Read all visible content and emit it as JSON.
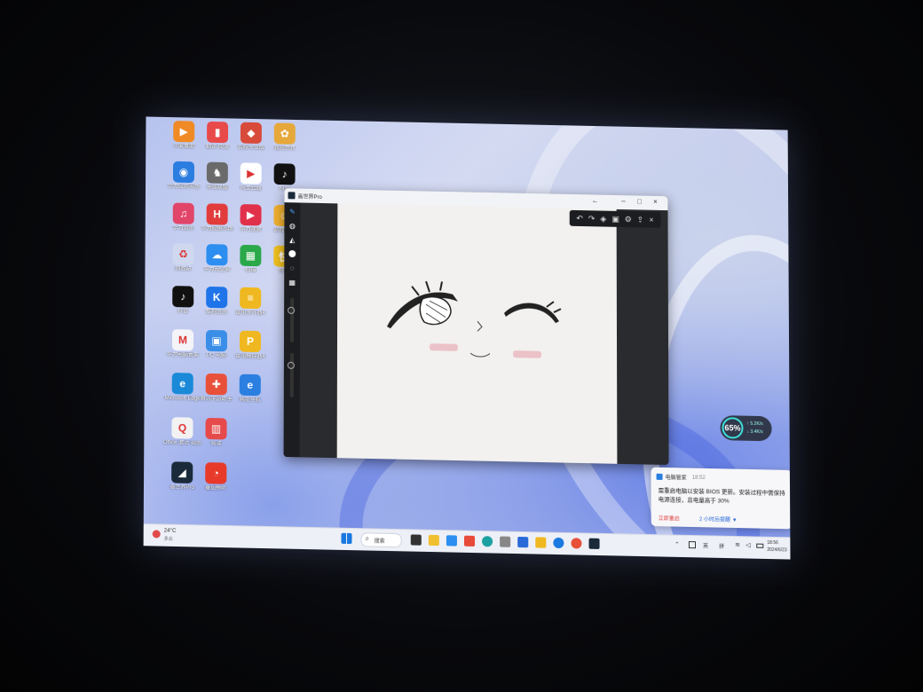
{
  "desktop": {
    "icons": [
      {
        "label": "小爱桌面",
        "glyph": "▶",
        "color": "#f08a24"
      },
      {
        "label": "翻译·阅读",
        "glyph": "▮",
        "color": "#e84a4a"
      },
      {
        "label": "剪映专业版",
        "glyph": "◆",
        "color": "#d84b3a"
      },
      {
        "label": "我的世界",
        "glyph": "✿",
        "color": "#e6a83a"
      },
      {
        "label": "华为应用市场",
        "glyph": "◉",
        "color": "#2b7de0"
      },
      {
        "label": "英雄联盟",
        "glyph": "♞",
        "color": "#6a6a6a"
      },
      {
        "label": "阿里云盘",
        "glyph": "▶",
        "color": "#ffffff"
      },
      {
        "label": "抖音",
        "glyph": "♪",
        "color": "#111111"
      },
      {
        "label": "华为音乐",
        "glyph": "♫",
        "color": "#e2456a"
      },
      {
        "label": "华为应用市场",
        "glyph": "H",
        "color": "#e23b3b"
      },
      {
        "label": "华为视频",
        "glyph": "▶",
        "color": "#e0304a"
      },
      {
        "label": "游戏加速",
        "glyph": "☺",
        "color": "#f0b030"
      },
      {
        "label": "回收站",
        "glyph": "♻",
        "color": "#cfd8ef"
      },
      {
        "label": "华为云空间",
        "glyph": "☁",
        "color": "#2c8ef0"
      },
      {
        "label": "扫描",
        "glyph": "▦",
        "color": "#2aa84a"
      },
      {
        "label": "快传",
        "glyph": "快",
        "color": "#f0c020"
      },
      {
        "label": "抖音",
        "glyph": "♪",
        "color": "#111111"
      },
      {
        "label": "酷狗音乐",
        "glyph": "K",
        "color": "#1e74e8"
      },
      {
        "label": "雷电多开器4",
        "glyph": "≡",
        "color": "#f0b820"
      },
      {
        "label": "华为电脑管家",
        "glyph": "M",
        "color": "#f4f4f8"
      },
      {
        "label": "PC 电脑",
        "glyph": "▣",
        "color": "#3a8ee8"
      },
      {
        "label": "雷电模拟器4",
        "glyph": "P",
        "color": "#f0b820"
      },
      {
        "label": "Microsoft Edge",
        "glyph": "e",
        "color": "#1a8ad8"
      },
      {
        "label": "腾讯手游助手",
        "glyph": "✚",
        "color": "#e8503a"
      },
      {
        "label": "网址导航",
        "glyph": "e",
        "color": "#2a7fe0"
      },
      {
        "label": "Office 激活 指南",
        "glyph": "Q",
        "color": "#f2f2f2"
      },
      {
        "label": "阅读",
        "glyph": "▥",
        "color": "#e64a4a"
      },
      {
        "label": "画世界Pro",
        "glyph": "◢",
        "color": "#1a2a3a"
      },
      {
        "label": "番茄畅听",
        "glyph": "◔",
        "color": "#e83a2a"
      }
    ]
  },
  "app_window": {
    "title": "画世界Pro",
    "back": "←",
    "minimize": "–",
    "maximize": "□",
    "close": "×",
    "toolbar": {
      "undo": "↶",
      "redo": "↷",
      "layers": "◈",
      "reference": "▣",
      "settings": "⚙",
      "share": "⇪",
      "close": "×"
    }
  },
  "widgets": {
    "performance": {
      "percent": "65%",
      "up": "5.2K/s",
      "down": "3.4K/s"
    },
    "notification": {
      "app": "电脑管家",
      "time": "18:52",
      "body": "需重启电脑以安装 BIOS 更新。安装过程中需保持电源连接，且电量高于 30%",
      "action_primary": "立即重启",
      "action_secondary": "2 小时后提醒"
    }
  },
  "taskbar": {
    "weather_temp": "24°C",
    "weather_desc": "多云",
    "search_label": "搜索",
    "ime": "英",
    "ime2": "拼",
    "time": "18:56",
    "date": "2024/6/23",
    "colors": {
      "accent": "#0a64d8"
    }
  }
}
